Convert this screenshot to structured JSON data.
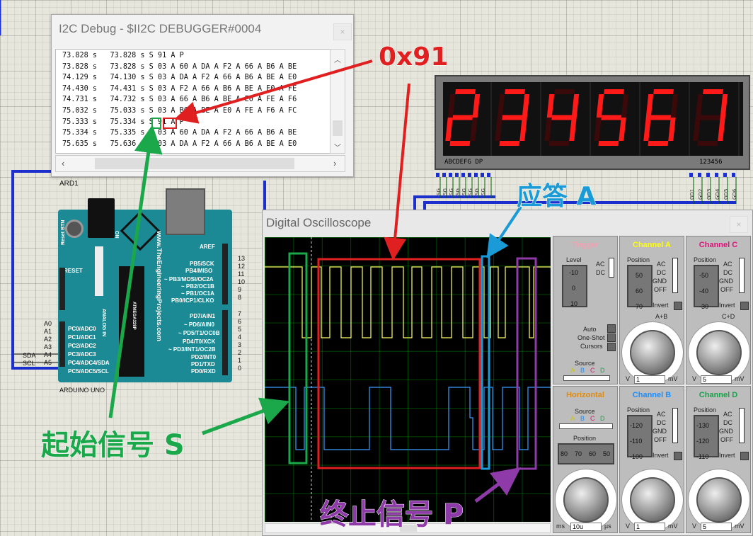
{
  "i2c_window": {
    "title": "I2C Debug - $II2C DEBUGGER#0004",
    "close": "×",
    "log": [
      "73.828 s   73.828 s S 91 A P",
      "73.828 s   73.828 s S 03 A 60 A DA A F2 A 66 A B6 A BE",
      "74.129 s   74.130 s S 03 A DA A F2 A 66 A B6 A BE A E0",
      "74.430 s   74.431 s S 03 A F2 A 66 A B6 A BE A E0 A FE",
      "74.731 s   74.732 s S 03 A 66 A B6 A BE A E0 A FE A F6",
      "75.032 s   75.033 s S 03 A B6 A BE A E0 A FE A F6 A FC",
      "75.333 s   75.334 s S 91 A P",
      "75.334 s   75.335 s S 03 A 60 A DA A F2 A 66 A B6 A BE",
      "75.635 s   75.636 s S 03 A DA A F2 A 66 A B6 A BE A E0"
    ]
  },
  "seven_seg": {
    "digits": [
      "2",
      "3",
      "4",
      "5",
      "6",
      "7"
    ],
    "left_label": "ABCDEFG  DP",
    "right_label": "123456",
    "bottom_pins_left": [
      "SG",
      "SG",
      "SG",
      "SG",
      "SG",
      "SG",
      "SG",
      "SG"
    ],
    "bottom_pins_right": [
      "GD1",
      "GD2",
      "GD3",
      "GD4",
      "GD5",
      "GD6"
    ],
    "color": "#ff1a1a"
  },
  "arduino": {
    "ref": "ARD1",
    "caption": "ARDUINO UNO",
    "reset_btn": "Reset BTN",
    "on": "ON",
    "reset": "RESET",
    "analog_in": "ANALOG IN",
    "url": "www.TheEngineeringProjects.com",
    "chip": "ATMEGA328P",
    "analog_pins": [
      "PC0/ADC0",
      "PC1/ADC1",
      "PC2/ADC2",
      "PC3/ADC3",
      "PC4/ADC4/SDA",
      "PC5/ADC5/SCL"
    ],
    "left_labels": [
      "A0",
      "A1",
      "A2",
      "A3",
      "A4",
      "A5"
    ],
    "sda": "SDA",
    "scl": "SCL",
    "right_pins_top": [
      "AREF",
      "PB5/SCK",
      "PB4/MISO",
      "~ PB3/MOSI/OC2A",
      "~ PB2/OC1B",
      "~ PB1/OC1A",
      "PB0/ICP1/CLKO"
    ],
    "right_nums_top": [
      "13",
      "12",
      "11",
      "10",
      "9",
      "8"
    ],
    "right_pins_bottom": [
      "PD7/AIN1",
      "~ PD6/AIN0",
      "~ PD5/T1/OC0B",
      "PD4/T0/XCK",
      "~ PD3/INT1/OC2B",
      "PD2/INT0",
      "PD1/TXD",
      "PD0/RXD"
    ],
    "right_nums_bottom": [
      "7",
      "6",
      "5",
      "4",
      "3",
      "2",
      "1",
      "0"
    ]
  },
  "oscilloscope": {
    "title": "Digital Oscilloscope",
    "close": "×",
    "trigger": {
      "title": "Trigger",
      "level": "Level",
      "ac": "AC",
      "dc": "DC",
      "auto": "Auto",
      "one_shot": "One-Shot",
      "cursors": "Cursors",
      "source": "Source",
      "sources": [
        "A",
        "B",
        "C",
        "D"
      ],
      "scale": [
        "-10",
        "0",
        "10"
      ]
    },
    "channel_a": {
      "title": "Channel A",
      "position": "Position",
      "scale": [
        "50",
        "60",
        "70"
      ],
      "ac": "AC",
      "dc": "DC",
      "gnd": "GND",
      "off": "OFF",
      "invert": "Invert",
      "extra": "A+B",
      "unit_v": "V",
      "value": "1",
      "unit": "mV",
      "color": "#ffff00"
    },
    "channel_c": {
      "title": "Channel C",
      "position": "Position",
      "scale": [
        "-50",
        "-40",
        "-30"
      ],
      "ac": "AC",
      "dc": "DC",
      "gnd": "GND",
      "off": "OFF",
      "invert": "Invert",
      "extra": "C+D",
      "unit_v": "V",
      "value": "5",
      "unit": "mV",
      "color": "#e0107a"
    },
    "horizontal": {
      "title": "Horizontal",
      "source": "Source",
      "sources": [
        "A",
        "B",
        "C",
        "D"
      ],
      "position": "Position",
      "scale": [
        "80",
        "70",
        "60",
        "50"
      ],
      "unit_ms": "ms",
      "value": "10u",
      "unit": "µs"
    },
    "channel_b": {
      "title": "Channel B",
      "position": "Position",
      "scale": [
        "-120",
        "-110",
        "-100"
      ],
      "ac": "AC",
      "dc": "DC",
      "gnd": "GND",
      "off": "OFF",
      "invert": "Invert",
      "unit_v": "V",
      "value": "1",
      "unit": "mV",
      "color": "#1a8fff"
    },
    "channel_d": {
      "title": "Channel D",
      "position": "Position",
      "scale": [
        "-130",
        "-120",
        "-110"
      ],
      "ac": "AC",
      "dc": "DC",
      "gnd": "GND",
      "off": "OFF",
      "invert": "Invert",
      "unit_v": "V",
      "value": "5",
      "unit": "mV",
      "color": "#16a34a"
    }
  },
  "annotations": {
    "hex": "0x91",
    "ack": "应答 A",
    "start": "起始信号 S",
    "stop": "终止信号 P"
  }
}
